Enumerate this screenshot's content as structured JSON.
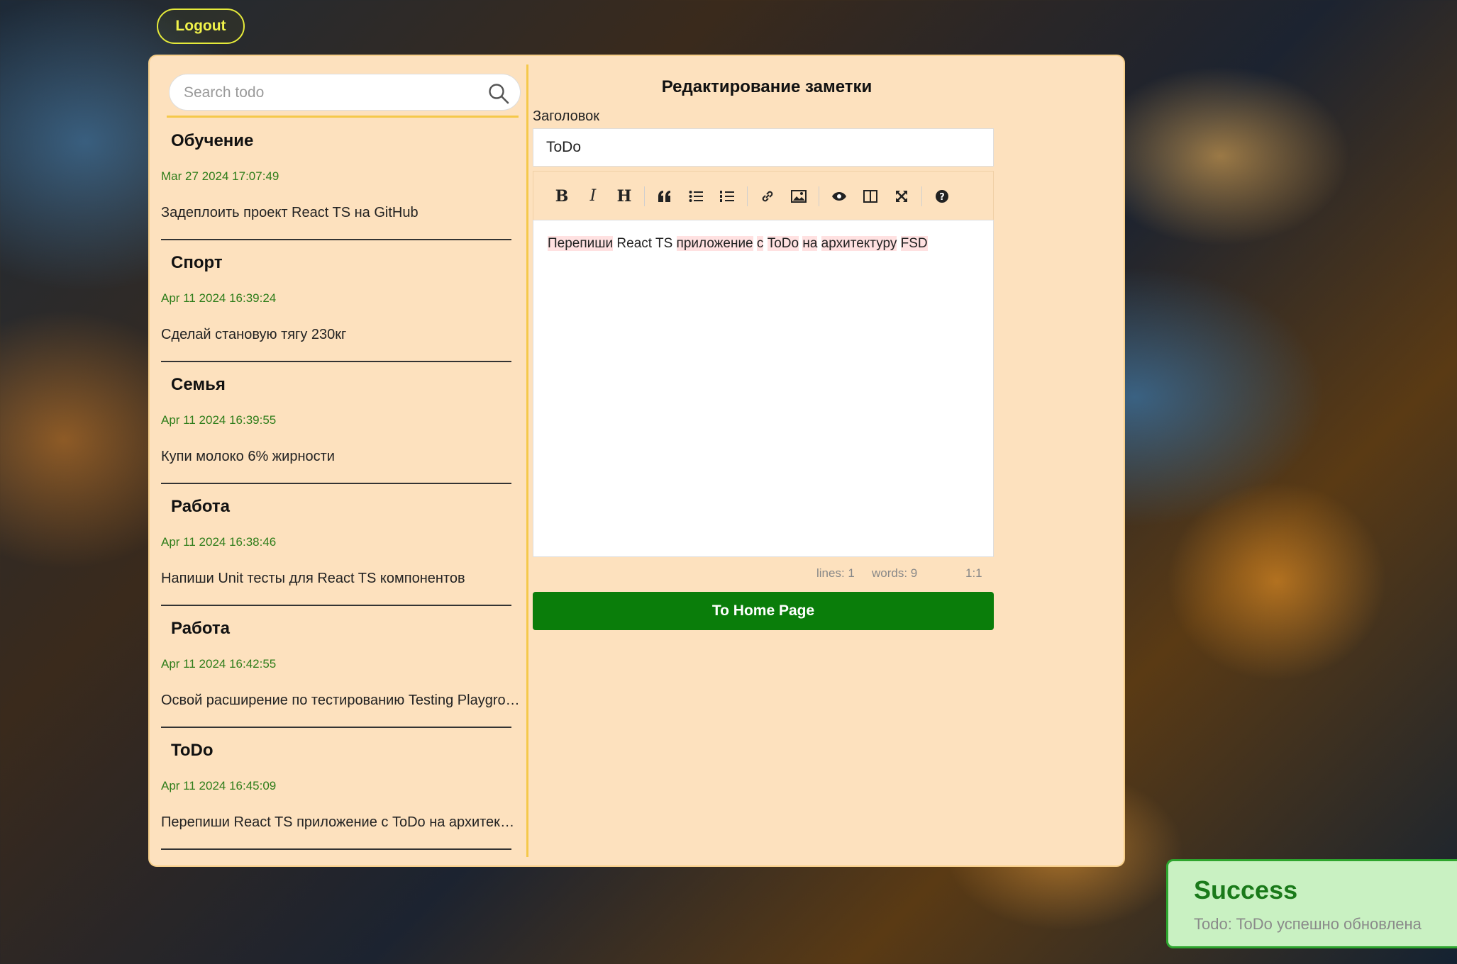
{
  "header": {
    "logout_label": "Logout"
  },
  "sidebar": {
    "search_placeholder": "Search todo",
    "notes": [
      {
        "title": "Обучение",
        "date": "Mar 27 2024 17:07:49",
        "body": "Задеплоить проект React TS на GitHub"
      },
      {
        "title": "Спорт",
        "date": "Apr 11 2024 16:39:24",
        "body": "Сделай становую тягу 230кг"
      },
      {
        "title": "Семья",
        "date": "Apr 11 2024 16:39:55",
        "body": "Купи молоко 6% жирности"
      },
      {
        "title": "Работа",
        "date": "Apr 11 2024 16:38:46",
        "body": "Напиши Unit тесты для React TS компонентов"
      },
      {
        "title": "Работа",
        "date": "Apr 11 2024 16:42:55",
        "body": "Освой расширение по тестированию Testing Playground"
      },
      {
        "title": "ToDo",
        "date": "Apr 11 2024 16:45:09",
        "body": "Перепиши React TS приложение с ToDo на архитектуру FSD"
      }
    ]
  },
  "editor": {
    "heading": "Редактирование заметки",
    "field_label": "Заголовок",
    "title_value": "ToDo",
    "content_words": [
      "Перепиши",
      "React",
      "TS",
      "приложение",
      "с",
      "ToDo",
      "на",
      "архитектуру",
      "FSD"
    ],
    "status": {
      "lines": "lines: 1",
      "words": "words: 9",
      "cursor": "1:1"
    },
    "home_button": "To Home Page",
    "toolbar": {
      "bold": "B",
      "italic": "I",
      "heading": "H"
    }
  },
  "toast": {
    "title": "Success",
    "message": "Todo: ToDo успешно обновлена",
    "accent": "#2ea52e"
  }
}
